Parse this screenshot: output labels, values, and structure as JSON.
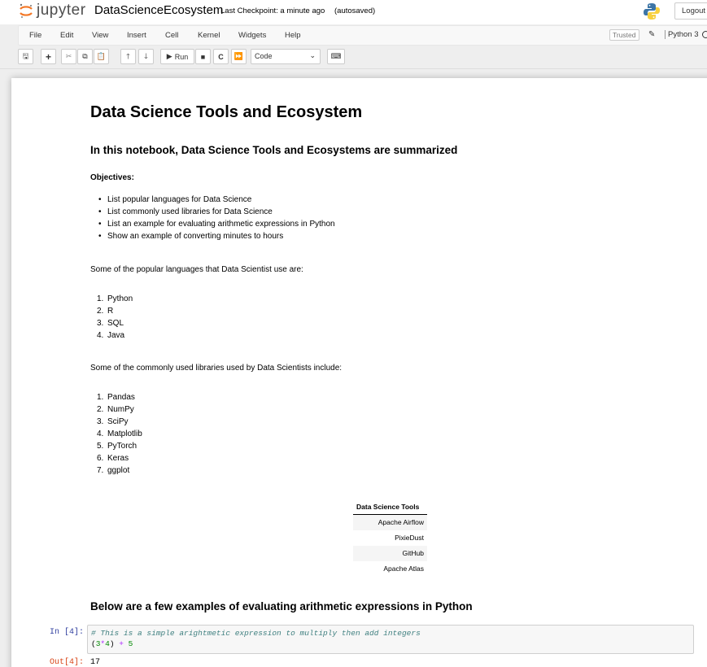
{
  "header": {
    "logo_text": "jupyter",
    "notebook_name": "DataScienceEcosystem",
    "checkpoint": "Last Checkpoint: a minute ago",
    "autosave": "(autosaved)",
    "logout_label": "Logout"
  },
  "menubar": {
    "items": [
      "File",
      "Edit",
      "View",
      "Insert",
      "Cell",
      "Kernel",
      "Widgets",
      "Help"
    ],
    "trusted": "Trusted",
    "kernel": "Python 3"
  },
  "toolbar": {
    "run_label": "Run",
    "cell_type": "Code"
  },
  "notebook": {
    "title": "Data Science Tools and Ecosystem",
    "intro": "In this notebook, Data Science Tools and Ecosystems are summarized",
    "objectives_label": "Objectives:",
    "objectives": [
      "List popular languages for Data Science",
      "List commonly used libraries for Data Science",
      "List an example for evaluating arithmetic expressions in Python",
      "Show an example of converting minutes to hours"
    ],
    "languages_intro": "Some of the popular languages that Data Scientist use are:",
    "languages": [
      "Python",
      "R",
      "SQL",
      "Java"
    ],
    "libraries_intro": "Some of the commonly used libraries used by Data Scientists include:",
    "libraries": [
      "Pandas",
      "NumPy",
      "SciPy",
      "Matplotlib",
      "PyTorch",
      "Keras",
      "ggplot"
    ],
    "tools_table": {
      "header": "Data Science Tools",
      "rows": [
        "Apache Airflow",
        "PixieDust",
        "GitHub",
        "Apache Atlas"
      ]
    },
    "examples_heading": "Below are a few examples of evaluating arithmetic expressions in Python",
    "code_cell": {
      "in_prompt": "In [4]:",
      "comment": "# This is a simple arightmetic expression to multiply then add integers",
      "out_prompt": "Out[4]:",
      "output": "17"
    }
  },
  "colors": {
    "in_prompt": "#303f9f",
    "out_prompt": "#d84315",
    "jupyter_orange": "#f37726"
  }
}
